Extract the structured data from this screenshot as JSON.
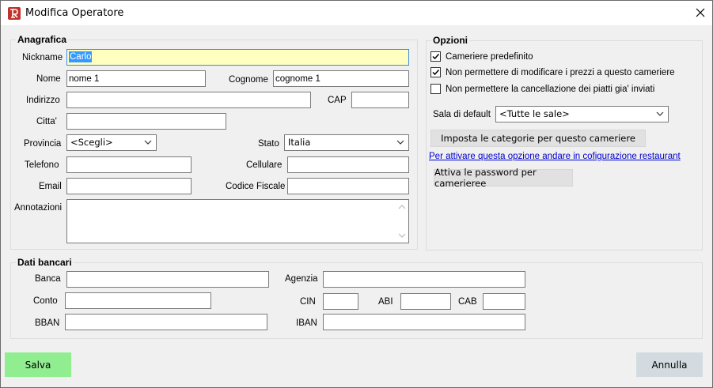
{
  "window": {
    "title": "Modifica Operatore"
  },
  "anagrafica": {
    "title": "Anagrafica",
    "nickname_label": "Nickname",
    "nickname_value": "Carlo",
    "nome_label": "Nome",
    "nome_value": "nome 1",
    "cognome_label": "Cognome",
    "cognome_value": "cognome 1",
    "indirizzo_label": "Indirizzo",
    "indirizzo_value": "",
    "cap_label": "CAP",
    "cap_value": "",
    "citta_label": "Citta'",
    "citta_value": "",
    "provincia_label": "Provincia",
    "provincia_value": "<Scegli>",
    "stato_label": "Stato",
    "stato_value": "Italia",
    "telefono_label": "Telefono",
    "telefono_value": "",
    "cellulare_label": "Cellulare",
    "cellulare_value": "",
    "email_label": "Email",
    "email_value": "",
    "codice_fiscale_label": "Codice Fiscale",
    "codice_fiscale_value": "",
    "annotazioni_label": "Annotazioni",
    "annotazioni_value": ""
  },
  "opzioni": {
    "title": "Opzioni",
    "checkboxes": [
      {
        "label": "Cameriere predefinito",
        "checked": true
      },
      {
        "label": "Non permettere di modificare i prezzi a questo cameriere",
        "checked": true
      },
      {
        "label": "Non permettere la cancellazione dei piatti gia' inviati",
        "checked": false
      }
    ],
    "sala_label": "Sala di default",
    "sala_value": "<Tutte le sale>",
    "categorie_button": "Imposta le categorie per questo cameriere",
    "link_text": "Per attivare questa opzione andare in cofigurazione restaurant",
    "password_button": "Attiva le password per camerieree"
  },
  "dati_bancari": {
    "title": "Dati bancari",
    "banca_label": "Banca",
    "agenzia_label": "Agenzia",
    "conto_label": "Conto",
    "cin_label": "CIN",
    "abi_label": "ABI",
    "cab_label": "CAB",
    "bban_label": "BBAN",
    "iban_label": "IBAN"
  },
  "footer": {
    "save_label": "Salva",
    "cancel_label": "Annulla"
  },
  "colors": {
    "save_button": "#90ee90",
    "cancel_button": "#d3dbe0",
    "nickname_highlight": "#ffffc0",
    "selection": "#3399ff"
  }
}
